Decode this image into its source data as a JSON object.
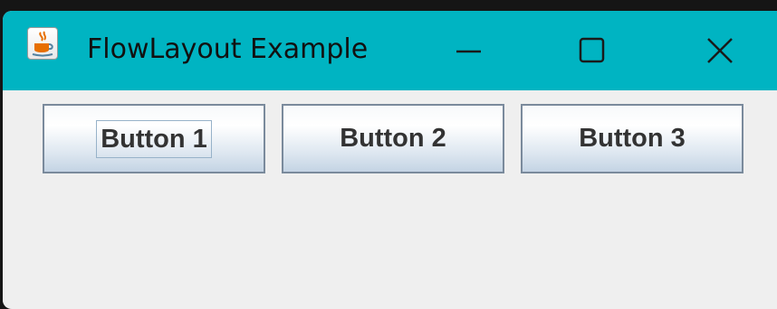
{
  "window": {
    "title": "FlowLayout Example",
    "app_icon": "java-coffee-cup-icon",
    "controls": [
      "minimize-icon",
      "maximize-icon",
      "close-icon"
    ]
  },
  "buttons": [
    {
      "label": "Button 1",
      "focused": true
    },
    {
      "label": "Button 2",
      "focused": false
    },
    {
      "label": "Button 3",
      "focused": false
    }
  ],
  "colors": {
    "titlebar": "#00b4c2",
    "content_bg": "#efefef",
    "button_border": "#7a8a9c",
    "button_text": "#333333"
  }
}
